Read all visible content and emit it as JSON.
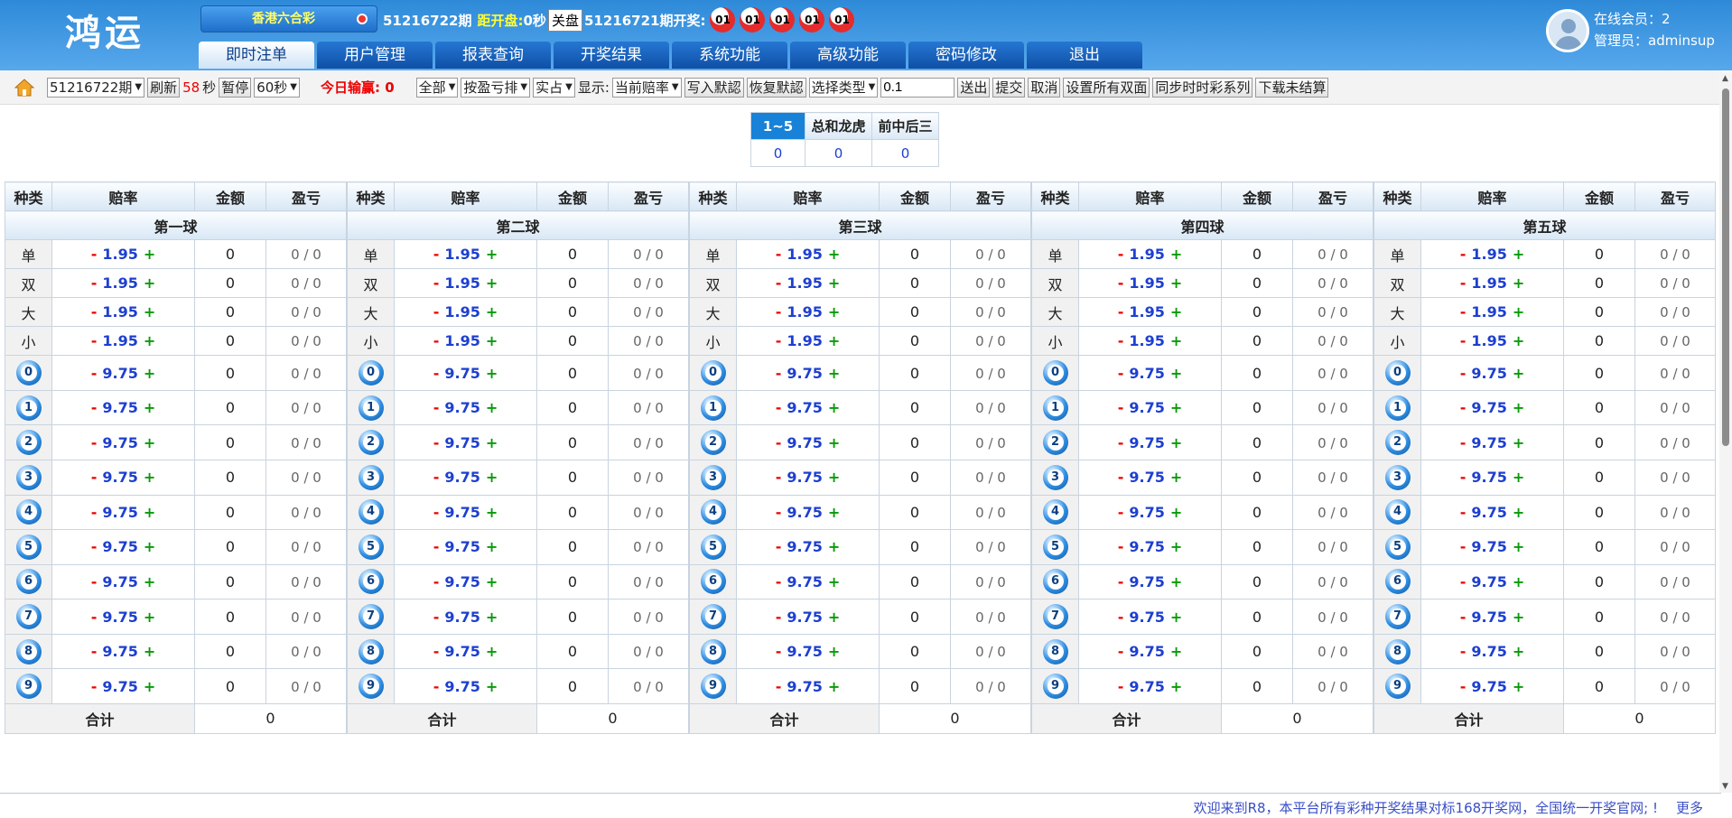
{
  "header": {
    "logo": "鸿运",
    "lottery": "香港六合彩",
    "current_period": "51216722期",
    "countdown_label": "距开盘:",
    "countdown_value": "0秒",
    "close_badge": "关盘",
    "last_period_label": "51216721期开奖:",
    "draw_balls": [
      "01",
      "01",
      "01",
      "01",
      "01"
    ],
    "online_members": "在线会员：2",
    "admin": "管理员：adminsup"
  },
  "nav": {
    "tabs": [
      "即时注单",
      "用户管理",
      "报表查询",
      "开奖结果",
      "系统功能",
      "高级功能",
      "密码修改",
      "退出"
    ],
    "active_index": 0
  },
  "toolbar": {
    "period_select": "51216722期",
    "refresh": "刷新",
    "seconds_value": "58",
    "seconds_unit": "秒",
    "pause": "暂停",
    "interval_select": "60秒",
    "today_label": "今日输赢:",
    "today_value": "0",
    "scope_select": "全部",
    "sort_select": "按盈亏排",
    "mode_select": "实占",
    "display_label": "显示:",
    "display_select": "当前赔率",
    "write_default": "写入默認",
    "restore_default": "恢复默認",
    "type_select": "选择类型",
    "amount_input": "0.1",
    "send_out": "送出",
    "submit": "提交",
    "cancel": "取消",
    "set_all_double": "设置所有双面",
    "sync_series": "同步时时彩系列",
    "download_unsettled": "下载未结算"
  },
  "categories": {
    "headers": [
      "1~5",
      "总和龙虎",
      "前中后三"
    ],
    "values": [
      "0",
      "0",
      "0"
    ],
    "selected_index": 0
  },
  "table": {
    "columns": [
      "种类",
      "赔率",
      "金额",
      "盈亏"
    ],
    "balls": [
      "第一球",
      "第二球",
      "第三球",
      "第四球",
      "第五球"
    ],
    "text_kinds": [
      "单",
      "双",
      "大",
      "小"
    ],
    "text_odds": "1.95",
    "number_kinds": [
      "0",
      "1",
      "2",
      "3",
      "4",
      "5",
      "6",
      "7",
      "8",
      "9"
    ],
    "number_odds": "9.75",
    "minus": "-",
    "plus": "+",
    "amount": "0",
    "profit": "0 / 0",
    "total_label": "合计",
    "total_value": "0"
  },
  "footer": {
    "marquee": "欢迎来到R8，本平台所有彩种开奖结果对标168开奖网，全国统一开奖官网; !",
    "more": "更多"
  },
  "colors": {
    "header_blue": "#2e8ad8",
    "nav_blue": "#0f4fa6",
    "odds_blue": "#1d3fd0",
    "minus_red": "#e00000",
    "plus_green": "#0a9a0a"
  }
}
